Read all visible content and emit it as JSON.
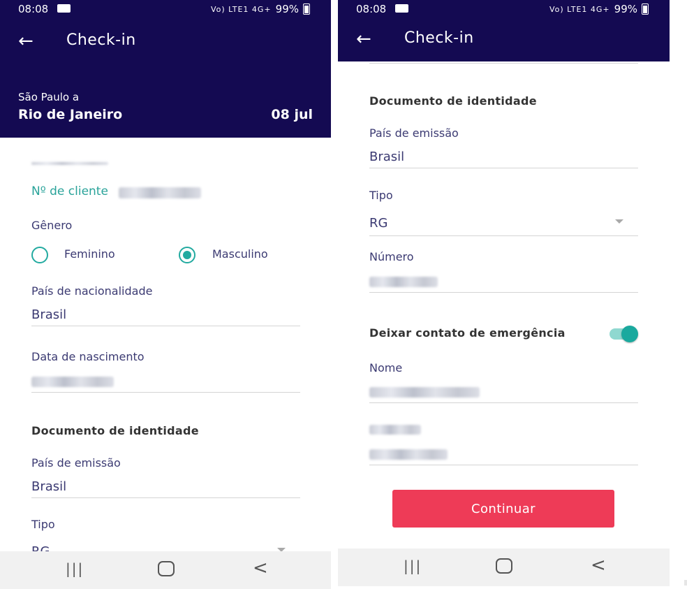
{
  "status_bar": {
    "time": "08:08",
    "network": "Vo) LTE1 4G+",
    "battery": "99%"
  },
  "left": {
    "title": "Check-in",
    "route_from": "São Paulo a",
    "route_to": "Rio de Janeiro",
    "date": "08 jul",
    "client_label": "Nº de cliente",
    "gender_label": "Gênero",
    "gender_options": [
      "Feminino",
      "Masculino"
    ],
    "nationality_label": "País de nacionalidade",
    "nationality_value": "Brasil",
    "birth_label": "Data de nascimento",
    "doc_section": "Documento de identidade",
    "issuer_label": "País de emissão",
    "issuer_value": "Brasil",
    "type_label": "Tipo",
    "type_value": "RG"
  },
  "right": {
    "title": "Check-in",
    "doc_section": "Documento de identidade",
    "issuer_label": "País de emissão",
    "issuer_value": "Brasil",
    "type_label": "Tipo",
    "type_value": "RG",
    "number_label": "Número",
    "emergency_label": "Deixar contato de emergência",
    "name_label": "Nome",
    "continue_label": "Continuar"
  },
  "nav": {
    "recents": "|||",
    "back": "<"
  },
  "colors": {
    "header": "#140a52",
    "accent": "#22aaa0",
    "button": "#ee3b57",
    "label": "#3b3a72"
  }
}
